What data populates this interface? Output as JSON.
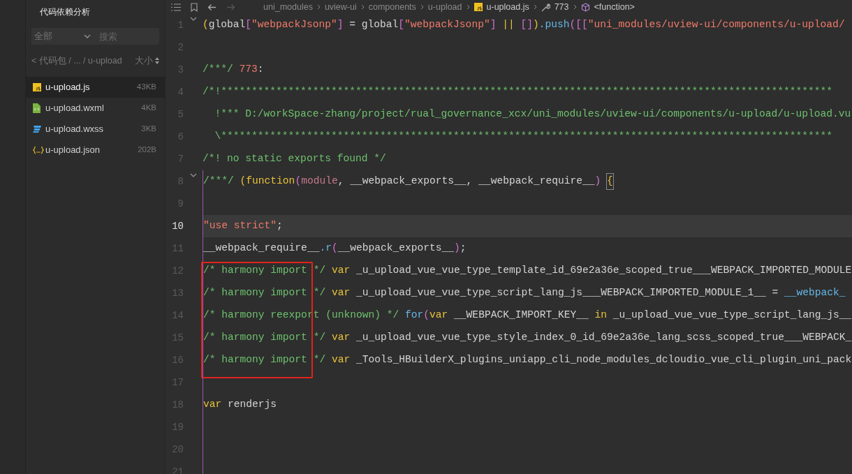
{
  "sidebar": {
    "title": "代码依赖分析",
    "filter": {
      "value": "全部",
      "search_placeholder": "搜索"
    },
    "path": "< 代码包 / ... / u-upload",
    "sort_label": "大小",
    "files": [
      {
        "name": "u-upload.js",
        "size": "43KB",
        "kind": "js",
        "selected": true
      },
      {
        "name": "u-upload.wxml",
        "size": "4KB",
        "kind": "wxml",
        "selected": false
      },
      {
        "name": "u-upload.wxss",
        "size": "3KB",
        "kind": "wxss",
        "selected": false
      },
      {
        "name": "u-upload.json",
        "size": "202B",
        "kind": "json",
        "selected": false
      }
    ]
  },
  "breadcrumb": [
    {
      "text": "uni_modules",
      "kind": "folder"
    },
    {
      "text": "uview-ui",
      "kind": "folder"
    },
    {
      "text": "components",
      "kind": "folder"
    },
    {
      "text": "u-upload",
      "kind": "folder"
    },
    {
      "text": "u-upload.js",
      "kind": "js"
    },
    {
      "text": "773",
      "kind": "wrench"
    },
    {
      "text": "<function>",
      "kind": "cube"
    }
  ],
  "editor": {
    "lines": [
      {
        "number": "1",
        "fold": true,
        "current": false,
        "tokens": [
          {
            "t": "(",
            "kind": "bracket1"
          },
          {
            "t": "global",
            "kind": "plain"
          },
          {
            "t": "[",
            "kind": "bracket2"
          },
          {
            "t": "\"webpackJsonp\"",
            "kind": "string"
          },
          {
            "t": "]",
            "kind": "bracket2"
          },
          {
            "t": " = global",
            "kind": "plain"
          },
          {
            "t": "[",
            "kind": "bracket2"
          },
          {
            "t": "\"webpackJsonp\"",
            "kind": "string"
          },
          {
            "t": "] ",
            "kind": "bracket2"
          },
          {
            "t": "|| ",
            "kind": "keyword"
          },
          {
            "t": "[]",
            "kind": "bracket2"
          },
          {
            "t": ")",
            "kind": "bracket1"
          },
          {
            "t": ".push",
            "kind": "func"
          },
          {
            "t": "([[",
            "kind": "bracket2"
          },
          {
            "t": "\"uni_modules/uview-ui/components/u-upload/",
            "kind": "string"
          }
        ]
      },
      {
        "number": "2",
        "current": false
      },
      {
        "number": "3",
        "current": false,
        "tokens": [
          {
            "t": "/***/ ",
            "kind": "comment"
          },
          {
            "t": "773",
            "kind": "number"
          },
          {
            "t": ":",
            "kind": "plain"
          }
        ]
      },
      {
        "number": "4",
        "current": false,
        "tokens": [
          {
            "t": "/*!****************************************************************************************************",
            "kind": "comment"
          }
        ]
      },
      {
        "number": "5",
        "current": false,
        "tokens": [
          {
            "t": "  !*** D:/workSpace-zhang/project/rual_governance_xcx/uni_modules/uview-ui/components/u-upload/u-upload.vu",
            "kind": "comment"
          }
        ]
      },
      {
        "number": "6",
        "current": false,
        "tokens": [
          {
            "t": "  \\****************************************************************************************************",
            "kind": "comment"
          }
        ]
      },
      {
        "number": "7",
        "current": false,
        "tokens": [
          {
            "t": "/*! no static exports found */",
            "kind": "comment"
          }
        ]
      },
      {
        "number": "8",
        "fold": true,
        "current": false,
        "tokens": [
          {
            "t": "/***/ ",
            "kind": "comment"
          },
          {
            "t": "(",
            "kind": "bracket1"
          },
          {
            "t": "function",
            "kind": "keyword"
          },
          {
            "t": "(",
            "kind": "bracket2"
          },
          {
            "t": "module",
            "kind": "param"
          },
          {
            "t": ", __webpack_exports__, __webpack_require__",
            "kind": "plain"
          },
          {
            "t": ") ",
            "kind": "bracket2"
          },
          {
            "t": "{",
            "kind": "match"
          }
        ]
      },
      {
        "number": "9",
        "current": false
      },
      {
        "number": "10",
        "current": true,
        "tokens": [
          {
            "t": "\"use strict\"",
            "kind": "string"
          },
          {
            "t": ";",
            "kind": "plain"
          }
        ]
      },
      {
        "number": "11",
        "current": false,
        "tokens": [
          {
            "t": "__webpack_require__",
            "kind": "plain"
          },
          {
            "t": ".r",
            "kind": "func"
          },
          {
            "t": "(",
            "kind": "bracket2"
          },
          {
            "t": "__webpack_exports__",
            "kind": "plain"
          },
          {
            "t": ")",
            "kind": "bracket2"
          },
          {
            "t": ";",
            "kind": "plain"
          }
        ]
      },
      {
        "number": "12",
        "current": false,
        "boxed": true,
        "tokens": [
          {
            "t": "/* harmony import */ ",
            "kind": "comment"
          },
          {
            "t": "var",
            "kind": "keyword"
          },
          {
            "t": " _u_upload_vue_vue_type_template_id_69e2a36e_scoped_true___WEBPACK_IMPORTED_MODULE",
            "kind": "plain"
          }
        ]
      },
      {
        "number": "13",
        "current": false,
        "boxed": true,
        "tokens": [
          {
            "t": "/* harmony import */ ",
            "kind": "comment"
          },
          {
            "t": "var",
            "kind": "keyword"
          },
          {
            "t": " _u_upload_vue_vue_type_script_lang_js___WEBPACK_IMPORTED_MODULE_1__ = ",
            "kind": "plain"
          },
          {
            "t": "__webpack_",
            "kind": "func"
          }
        ]
      },
      {
        "number": "14",
        "current": false,
        "boxed": true,
        "tokens": [
          {
            "t": "/* harmony reexport (unknown) */ ",
            "kind": "comment"
          },
          {
            "t": "for",
            "kind": "control"
          },
          {
            "t": "(",
            "kind": "bracket2"
          },
          {
            "t": "var",
            "kind": "keyword"
          },
          {
            "t": " __WEBPACK_IMPORT_KEY__ ",
            "kind": "plain"
          },
          {
            "t": "in",
            "kind": "keyword"
          },
          {
            "t": " _u_upload_vue_vue_type_script_lang_js__",
            "kind": "plain"
          }
        ]
      },
      {
        "number": "15",
        "current": false,
        "boxed": true,
        "tokens": [
          {
            "t": "/* harmony import */ ",
            "kind": "comment"
          },
          {
            "t": "var",
            "kind": "keyword"
          },
          {
            "t": " _u_upload_vue_vue_type_style_index_0_id_69e2a36e_lang_scss_scoped_true___WEBPACK_",
            "kind": "plain"
          }
        ]
      },
      {
        "number": "16",
        "current": false,
        "boxed": true,
        "tokens": [
          {
            "t": "/* harmony import */ ",
            "kind": "comment"
          },
          {
            "t": "var",
            "kind": "keyword"
          },
          {
            "t": " _Tools_HBuilderX_plugins_uniapp_cli_node_modules_dcloudio_vue_cli_plugin_uni_pack",
            "kind": "plain"
          }
        ]
      },
      {
        "number": "17",
        "current": false
      },
      {
        "number": "18",
        "current": false,
        "tokens": [
          {
            "t": "var",
            "kind": "keyword"
          },
          {
            "t": " renderjs",
            "kind": "plain"
          }
        ]
      },
      {
        "number": "19",
        "current": false
      },
      {
        "number": "20",
        "current": false
      },
      {
        "number": "21",
        "current": false
      }
    ]
  }
}
